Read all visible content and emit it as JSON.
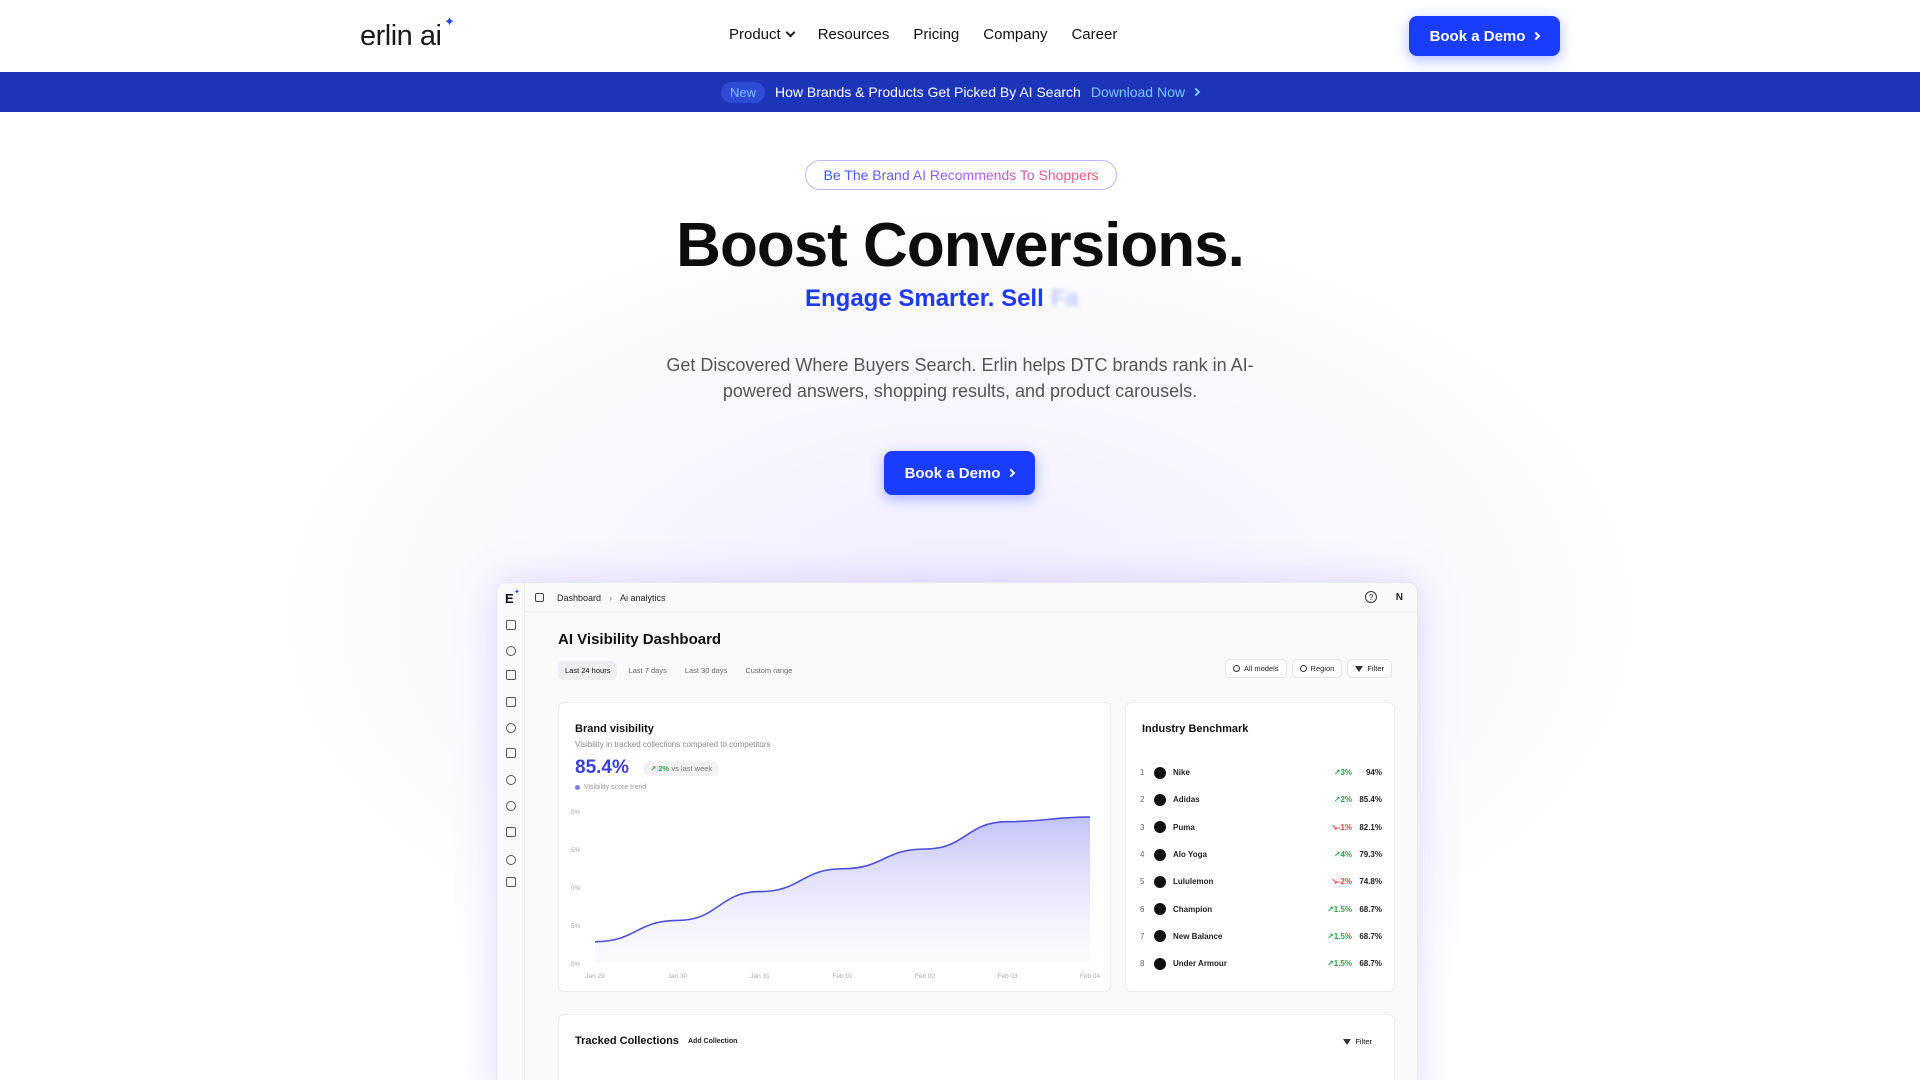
{
  "header": {
    "logo": "erlin ai",
    "nav": [
      {
        "label": "Product",
        "dropdown": true
      },
      {
        "label": "Resources"
      },
      {
        "label": "Pricing"
      },
      {
        "label": "Company"
      },
      {
        "label": "Career"
      }
    ],
    "cta": "Book a Demo"
  },
  "banner": {
    "badge": "New",
    "text": "How Brands & Products Get Picked By AI Search",
    "link": "Download Now"
  },
  "hero": {
    "pill": "Be The Brand AI Recommends To Shoppers",
    "title": "Boost Conversions.",
    "subtitle": "Engage Smarter. Sell",
    "subtitle_fading": "Fa",
    "description": "Get Discovered Where Buyers Search. Erlin helps DTC brands rank in AI-powered answers, shopping results, and product carousels.",
    "cta": "Book a Demo"
  },
  "dashboard": {
    "logo": "E",
    "breadcrumb": [
      "Dashboard",
      "Ai analytics"
    ],
    "user_initial": "N",
    "help": "?",
    "title": "AI Visibility Dashboard",
    "ranges": [
      "Last 24 hours",
      "Last 7 days",
      "Last 30 days",
      "Custom range"
    ],
    "filters": [
      "All models",
      "Region",
      "Filter"
    ],
    "brand_visibility": {
      "title": "Brand visibility",
      "description": "Visibility in tracked collections compared to competitors",
      "value": "85.4%",
      "delta": "2%",
      "delta_suffix": "vs last week",
      "legend": "Visibility score trend"
    },
    "industry_benchmark": {
      "title": "Industry Benchmark",
      "rows": [
        {
          "rank": "1",
          "name": "Nike",
          "change": "3%",
          "dir": "up",
          "pct": "94%"
        },
        {
          "rank": "2",
          "name": "Adidas",
          "change": "2%",
          "dir": "up",
          "pct": "85.4%"
        },
        {
          "rank": "3",
          "name": "Puma",
          "change": "-1%",
          "dir": "down",
          "pct": "82.1%"
        },
        {
          "rank": "4",
          "name": "Alo Yoga",
          "change": "4%",
          "dir": "up",
          "pct": "79.3%"
        },
        {
          "rank": "5",
          "name": "Lululemon",
          "change": "-2%",
          "dir": "down",
          "pct": "74.8%"
        },
        {
          "rank": "6",
          "name": "Champion",
          "change": "1.5%",
          "dir": "up",
          "pct": "68.7%"
        },
        {
          "rank": "7",
          "name": "New Balance",
          "change": "1.5%",
          "dir": "up",
          "pct": "68.7%"
        },
        {
          "rank": "8",
          "name": "Under Armour",
          "change": "1.5%",
          "dir": "up",
          "pct": "68.7%"
        }
      ]
    },
    "tracked_collections": {
      "title": "Tracked Collections",
      "add": "Add Collection",
      "filter": "Filter"
    }
  },
  "chart_data": {
    "type": "area",
    "title": "",
    "xlabel": "",
    "ylabel": "",
    "x": [
      "Jan 29",
      "Jan 30",
      "Jan 31",
      "Feb 01",
      "Feb 02",
      "Feb 03",
      "Feb 04"
    ],
    "ytick_labels": [
      "0%",
      "5%",
      "0%",
      "5%",
      "0%"
    ],
    "series": [
      {
        "values": [
          0.14,
          0.28,
          0.47,
          0.62,
          0.75,
          0.93,
          0.96
        ]
      }
    ],
    "ylim": [
      0,
      1
    ],
    "grid": false,
    "color": "#4b4fd8"
  }
}
